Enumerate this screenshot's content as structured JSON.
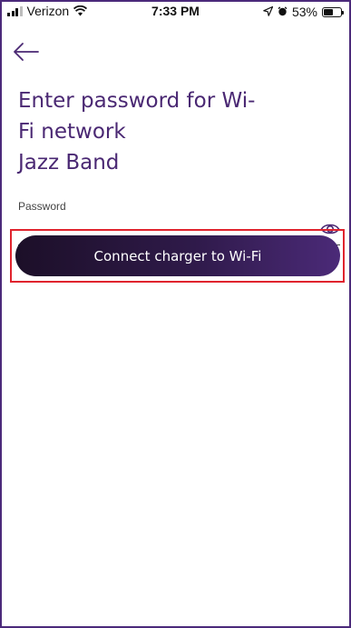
{
  "status_bar": {
    "carrier": "Verizon",
    "time": "7:33 PM",
    "battery_percent_label": "53%",
    "battery_level": 0.53
  },
  "icons": {
    "back": "arrow-left",
    "show_password": "eye",
    "signal": "cellular-signal",
    "wifi": "wifi",
    "location": "location-arrow",
    "alarm": "alarm-clock",
    "battery": "battery"
  },
  "page": {
    "title_lines": [
      "Enter password for Wi-",
      "Fi network",
      "Jazz Band"
    ]
  },
  "password_field": {
    "label": "Password",
    "value": ""
  },
  "connect_button": {
    "label": "Connect charger to Wi-Fi"
  },
  "colors": {
    "accent": "#4a2873",
    "button_gradient_start": "#1c0f28",
    "button_gradient_end": "#4b2a78",
    "highlight": "#e0242e"
  }
}
